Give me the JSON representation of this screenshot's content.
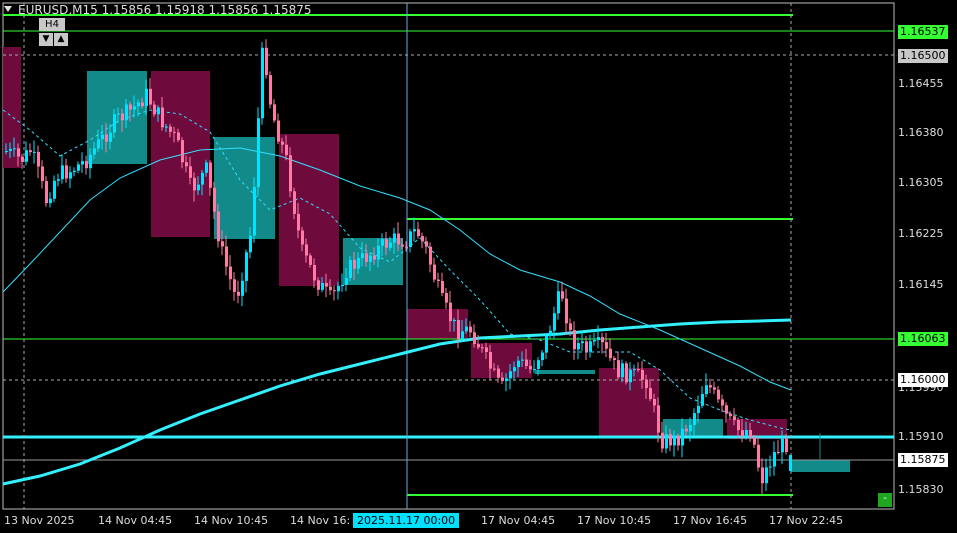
{
  "header": {
    "symbol_line": "EURUSD,M15  1.15856 1.15918 1.15856 1.15875",
    "tf_badge": "H4",
    "btn_down": "▼",
    "btn_up": "▲"
  },
  "price_axis": {
    "ticks": [
      "1.16455",
      "1.16380",
      "1.16305",
      "1.16225",
      "1.16145",
      "1.15990",
      "1.15910",
      "1.15830"
    ],
    "labels": [
      {
        "text": "1.16537",
        "bg": "#33ff33",
        "fg": "#000000"
      },
      {
        "text": "1.16500",
        "bg": "#c8c8c8",
        "fg": "#000000"
      },
      {
        "text": "1.16063",
        "bg": "#33ff33",
        "fg": "#000000"
      },
      {
        "text": "1.16000",
        "bg": "#ffffff",
        "fg": "#000000"
      },
      {
        "text": "1.15875",
        "bg": "#ffffff",
        "fg": "#000000"
      }
    ]
  },
  "time_axis": {
    "labels": [
      "13 Nov 2025",
      "14 Nov 04:45",
      "14 Nov 10:45",
      "14 Nov 16:",
      "17 Nov 04:45",
      "17 Nov 10:45",
      "17 Nov 16:45",
      "17 Nov 22:45"
    ],
    "cursor_label": "2025.11.17 00:00"
  },
  "mini_button": "-",
  "colors": {
    "bull": "#00e5ff",
    "bear": "#ff7aa8",
    "htf_bull": "#138a8a",
    "htf_bear": "#6e0a3c",
    "ma_slow": "#33f0ff",
    "level_green": "#33ff33"
  },
  "chart_data": {
    "type": "candlestick",
    "symbol": "EURUSD",
    "timeframe": "M15",
    "ohlc_last": {
      "open": 1.15856,
      "high": 1.15918,
      "low": 1.15856,
      "close": 1.15875
    },
    "levels": [
      1.16537,
      1.16063,
      1.1591,
      1.1583
    ]
  }
}
